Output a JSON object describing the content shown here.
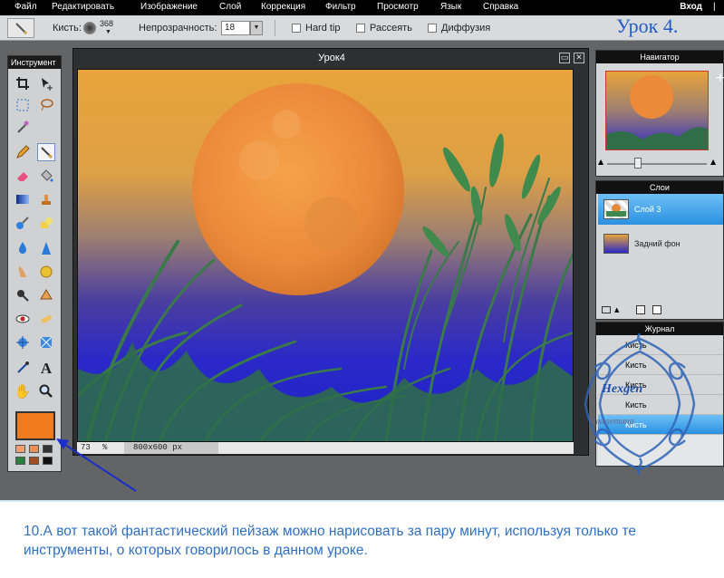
{
  "menu": {
    "items": [
      "Файл",
      "Редактировать",
      "Изображение",
      "Слой",
      "Коррекция",
      "Фильтр",
      "Просмотр",
      "Язык",
      "Справка"
    ],
    "login": "Вход",
    "signup": "|"
  },
  "options": {
    "brush_label": "Кисть:",
    "brush_size": "368",
    "opacity_label": "Непрозрачность:",
    "opacity_value": "18",
    "hard_tip": "Hard tip",
    "scatter": "Рассеять",
    "diffusion": "Диффузия"
  },
  "lesson_title": "Урок 4.",
  "toolbox": {
    "title": "Инструмент",
    "primary_color": "#f07a1e"
  },
  "document": {
    "title": "Урок4",
    "zoom": "73",
    "zoom_unit": "%",
    "size": "800x600 px"
  },
  "navigator": {
    "title": "Навигатор"
  },
  "layers": {
    "title": "Слои",
    "items": [
      {
        "name": "Слой 3",
        "selected": true
      },
      {
        "name": "Задний фон",
        "selected": false
      }
    ]
  },
  "journal": {
    "title": "Журнал",
    "items": [
      "Кисть",
      "Кисть",
      "Кисть",
      "Кисть",
      "Кисть"
    ]
  },
  "watermark": {
    "line1": "Hexgen",
    "line2": "рикелетина"
  },
  "caption": "10.А вот такой фантастический пейзаж можно нарисовать за пару минут, используя только те инструменты, о которых говорилось в данном уроке."
}
